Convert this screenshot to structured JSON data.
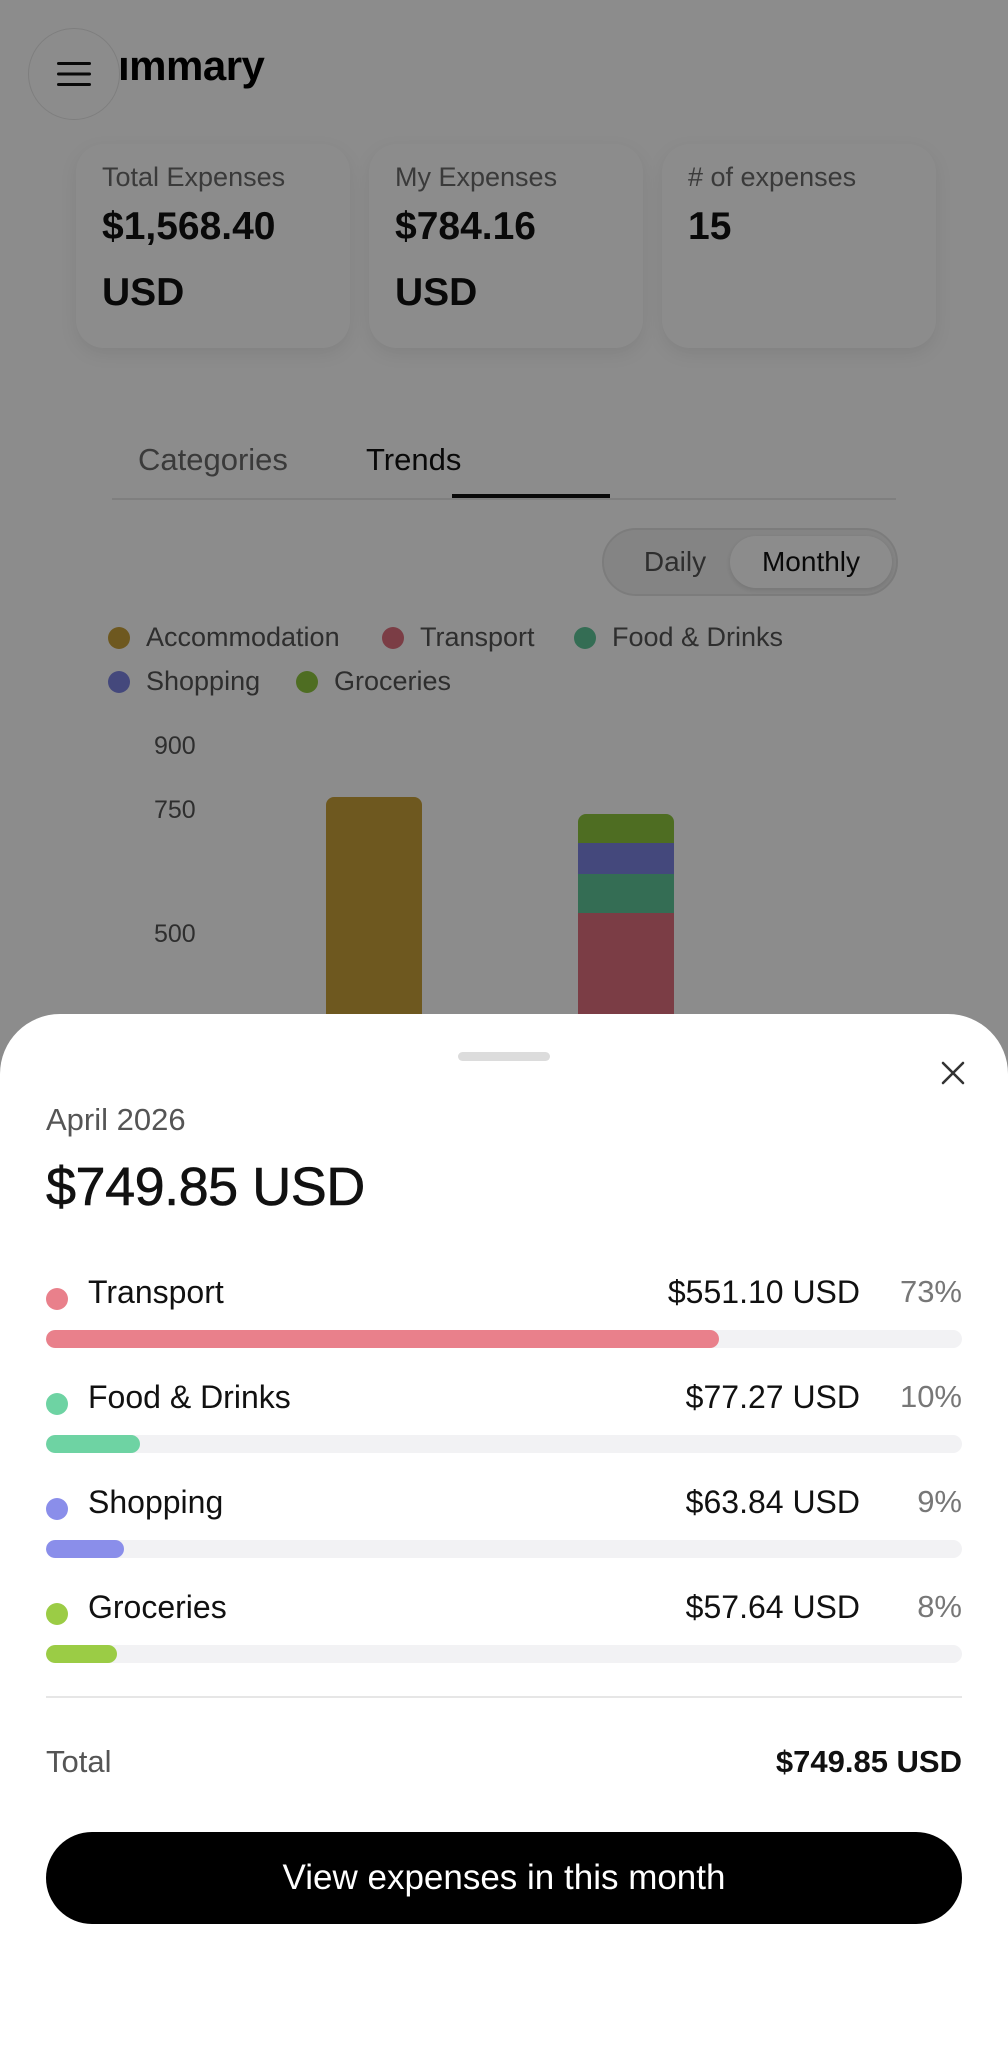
{
  "header": {
    "title": "ımmary",
    "menu_icon": "hamburger-menu-icon"
  },
  "stats": [
    {
      "label": "Total Expenses",
      "value_line1": "$1,568.40",
      "value_line2": "USD"
    },
    {
      "label": "My Expenses",
      "value_line1": "$784.16",
      "value_line2": "USD"
    },
    {
      "label": "# of expenses",
      "value_line1": "15",
      "value_line2": ""
    }
  ],
  "tabs": {
    "categories": "Categories",
    "trends": "Trends",
    "active": "Trends"
  },
  "granularity": {
    "daily": "Daily",
    "monthly": "Monthly",
    "selected": "Monthly"
  },
  "legend": [
    {
      "name": "Accommodation",
      "color": "#c9a13a"
    },
    {
      "name": "Transport",
      "color": "#e0707f"
    },
    {
      "name": "Food & Drinks",
      "color": "#5fc79a"
    },
    {
      "name": "Shopping",
      "color": "#7c84e2"
    },
    {
      "name": "Groceries",
      "color": "#8ec63f"
    }
  ],
  "chart_data": {
    "type": "bar",
    "stacked": true,
    "ytick_labels": [
      "900",
      "750",
      "500"
    ],
    "bars": [
      {
        "segments": [
          {
            "series": "Accommodation",
            "value": 784.21
          }
        ]
      },
      {
        "segments": [
          {
            "series": "Transport",
            "value": 551.1
          },
          {
            "series": "Food & Drinks",
            "value": 77.27
          },
          {
            "series": "Shopping",
            "value": 63.84
          },
          {
            "series": "Groceries",
            "value": 57.64
          }
        ]
      }
    ]
  },
  "sheet": {
    "month": "April 2026",
    "total": "$749.85 USD",
    "close_icon": "close-icon",
    "categories": [
      {
        "name": "Transport",
        "amount": "$551.10 USD",
        "percent": "73%",
        "share": 0.735,
        "color": "#e9808b"
      },
      {
        "name": "Food & Drinks",
        "amount": "$77.27 USD",
        "percent": "10%",
        "share": 0.103,
        "color": "#6ed3a3"
      },
      {
        "name": "Shopping",
        "amount": "$63.84 USD",
        "percent": "9%",
        "share": 0.085,
        "color": "#8a8eea"
      },
      {
        "name": "Groceries",
        "amount": "$57.64 USD",
        "percent": "8%",
        "share": 0.077,
        "color": "#9bcc45"
      }
    ],
    "total_label": "Total",
    "total_value": "$749.85 USD",
    "cta_label": "View expenses in this month"
  }
}
